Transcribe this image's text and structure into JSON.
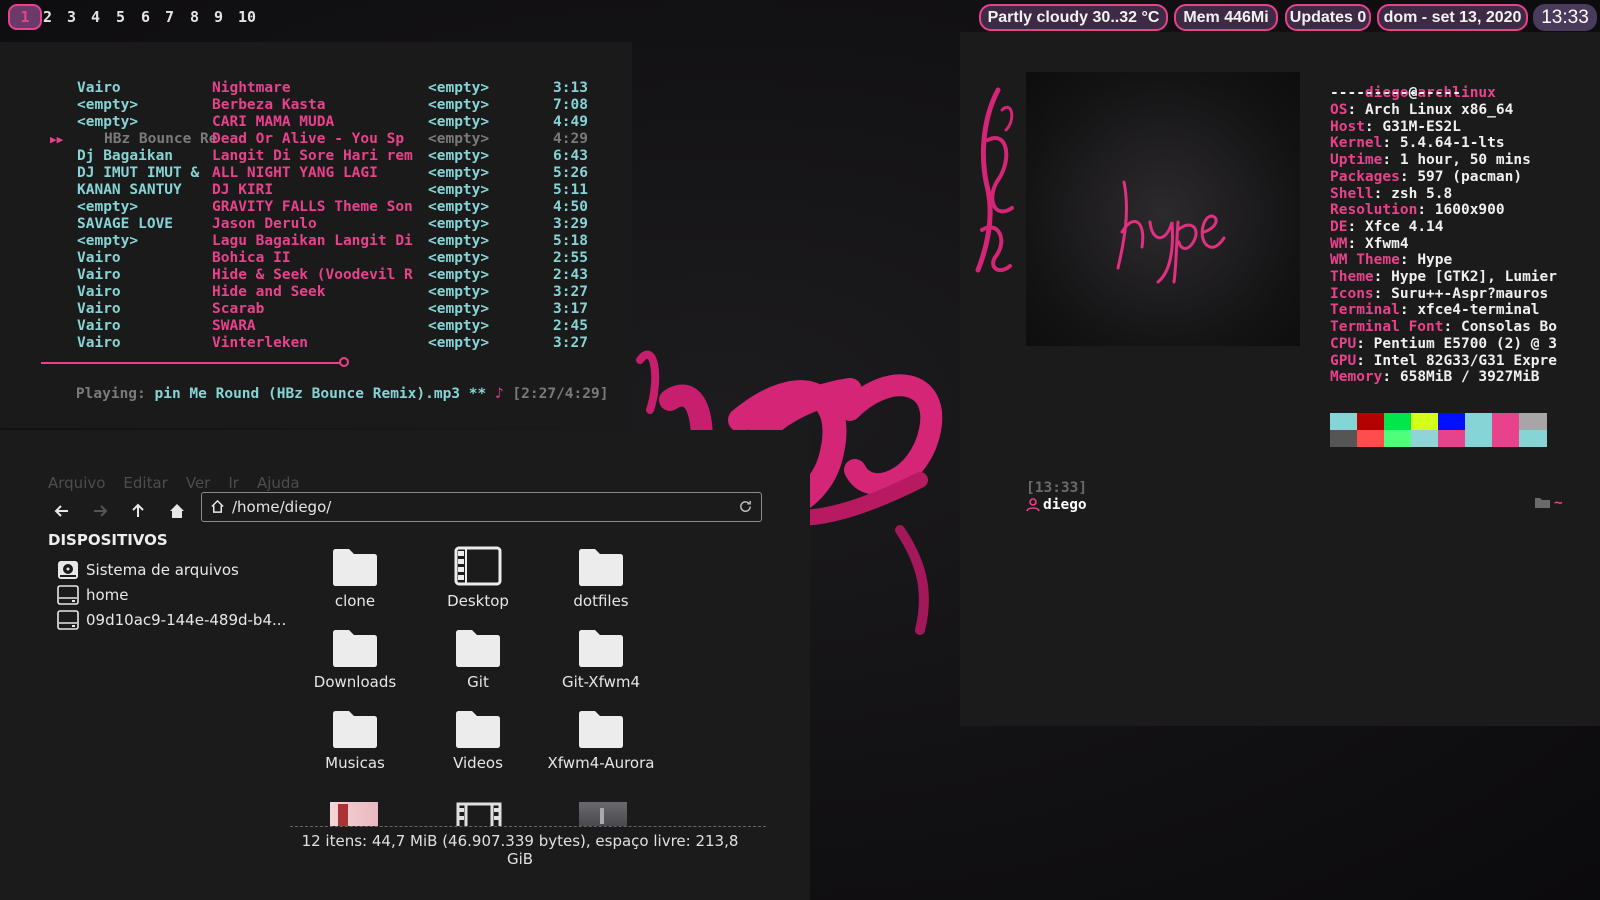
{
  "colors": {
    "accent": "#e8428c",
    "cyan": "#86d4d6",
    "bar_bg": "#3e2a44"
  },
  "workspaces": [
    "1",
    "2",
    "3",
    "4",
    "5",
    "6",
    "7",
    "8",
    "9",
    "10"
  ],
  "active_workspace": "1",
  "status": {
    "weather": "Partly cloudy 30..32 °C",
    "memory": "Mem 446Mi",
    "updates": "Updates 0",
    "date": "dom - set 13, 2020",
    "clock": "13:33"
  },
  "player": {
    "tracks": [
      {
        "artist": "Vairo",
        "title": "Nightmare",
        "album": "<empty>",
        "duration": "3:13"
      },
      {
        "artist": "<empty>",
        "title": "Berbeza Kasta",
        "album": "<empty>",
        "duration": "7:08"
      },
      {
        "artist": "<empty>",
        "title": "CARI MAMA MUDA",
        "album": "<empty>",
        "duration": "4:49"
      },
      {
        "artist": "HBz Bounce Re",
        "title": "Dead Or Alive - You Sp",
        "album": "<empty>",
        "duration": "4:29",
        "playing": true
      },
      {
        "artist": "Dj Bagaikan",
        "title": "Langit Di Sore Hari rem",
        "album": "<empty>",
        "duration": "6:43"
      },
      {
        "artist": "DJ IMUT IMUT &",
        "title": "ALL NIGHT YANG LAGI",
        "album": "<empty>",
        "duration": "5:26"
      },
      {
        "artist": "KANAN SANTUY",
        "title": "DJ KIRI",
        "album": "<empty>",
        "duration": "5:11"
      },
      {
        "artist": "<empty>",
        "title": "GRAVITY FALLS Theme Son",
        "album": "<empty>",
        "duration": "4:50"
      },
      {
        "artist": "SAVAGE LOVE",
        "title": "Jason Derulo",
        "album": "<empty>",
        "duration": "3:29"
      },
      {
        "artist": "<empty>",
        "title": "Lagu Bagaikan Langit Di",
        "album": "<empty>",
        "duration": "5:18"
      },
      {
        "artist": "Vairo",
        "title": "Bohica II",
        "album": "<empty>",
        "duration": "2:55"
      },
      {
        "artist": "Vairo",
        "title": "Hide & Seek (Voodevil R",
        "album": "<empty>",
        "duration": "2:43"
      },
      {
        "artist": "Vairo",
        "title": "Hide and Seek",
        "album": "<empty>",
        "duration": "3:27"
      },
      {
        "artist": "Vairo",
        "title": "Scarab",
        "album": "<empty>",
        "duration": "3:17"
      },
      {
        "artist": "Vairo",
        "title": "SWARA",
        "album": "<empty>",
        "duration": "2:45"
      },
      {
        "artist": "Vairo",
        "title": "Vinterleken",
        "album": "<empty>",
        "duration": "3:27"
      }
    ],
    "playing_marker": "▶▶",
    "status_prefix": "Playing: ",
    "status_song": "pin Me Round (HBz Bounce Remix).mp3",
    "status_flags": " ** ",
    "status_note": "♪",
    "status_time": " [2:27/4:29]",
    "progress": 0.56
  },
  "file_manager": {
    "menu": [
      "Arquivo",
      "Editar",
      "Ver",
      "Ir",
      "Ajuda"
    ],
    "path": "/home/diego/",
    "devices_title": "DISPOSITIVOS",
    "devices": [
      {
        "label": "Sistema de arquivos",
        "icon": "harddisk-icon"
      },
      {
        "label": "home",
        "icon": "drive-icon"
      },
      {
        "label": "09d10ac9-144e-489d-b4...",
        "icon": "drive-icon"
      }
    ],
    "items": [
      {
        "label": "clone",
        "icon": "folder-icon"
      },
      {
        "label": "Desktop",
        "icon": "desktop-folder-icon"
      },
      {
        "label": "dotfiles",
        "icon": "folder-icon"
      },
      {
        "label": "Downloads",
        "icon": "folder-icon"
      },
      {
        "label": "Git",
        "icon": "folder-icon"
      },
      {
        "label": "Git-Xfwm4",
        "icon": "folder-icon"
      },
      {
        "label": "Musicas",
        "icon": "folder-icon"
      },
      {
        "label": "Videos",
        "icon": "folder-icon"
      },
      {
        "label": "Xfwm4-Aurora",
        "icon": "folder-icon"
      }
    ],
    "status": "12 itens: 44,7 MiB (46.907.339 bytes), espaço livre: 213,8 GiB"
  },
  "neofetch": {
    "user": "diego",
    "at": "@",
    "host": "archlinux",
    "separator": "---------------",
    "info": [
      {
        "key": "OS",
        "value": "Arch Linux x86_64"
      },
      {
        "key": "Host",
        "value": "G31M-ES2L"
      },
      {
        "key": "Kernel",
        "value": "5.4.64-1-lts"
      },
      {
        "key": "Uptime",
        "value": "1 hour, 50 mins"
      },
      {
        "key": "Packages",
        "value": "597 (pacman)"
      },
      {
        "key": "Shell",
        "value": "zsh 5.8"
      },
      {
        "key": "Resolution",
        "value": "1600x900"
      },
      {
        "key": "DE",
        "value": "Xfce 4.14"
      },
      {
        "key": "WM",
        "value": "Xfwm4"
      },
      {
        "key": "WM Theme",
        "value": "Hype"
      },
      {
        "key": "Theme",
        "value": "Hype [GTK2], Lumier"
      },
      {
        "key": "Icons",
        "value": "Suru++-Aspr?mauros"
      },
      {
        "key": "Terminal",
        "value": "xfce4-terminal"
      },
      {
        "key": "Terminal Font",
        "value": "Consolas Bo"
      },
      {
        "key": "CPU",
        "value": "Pentium E5700 (2) @ 3"
      },
      {
        "key": "GPU",
        "value": "Intel 82G33/G31 Expre"
      },
      {
        "key": "Memory",
        "value": "658MiB / 3927MiB"
      }
    ],
    "palette_top": [
      "#86d4d6",
      "#b30000",
      "#00e64d",
      "#d4ff1a",
      "#0010ff",
      "#86d4d6",
      "#e8428c",
      "#a6a6a6"
    ],
    "palette_bottom": [
      "#555555",
      "#ff4d4d",
      "#4dff7a",
      "#8fd4d6",
      "#e8428c",
      "#86d4d6",
      "#e8428c",
      "#86d4d6"
    ],
    "prompt_time": "[13:33]",
    "prompt_user": "diego",
    "prompt_dir": "~"
  }
}
